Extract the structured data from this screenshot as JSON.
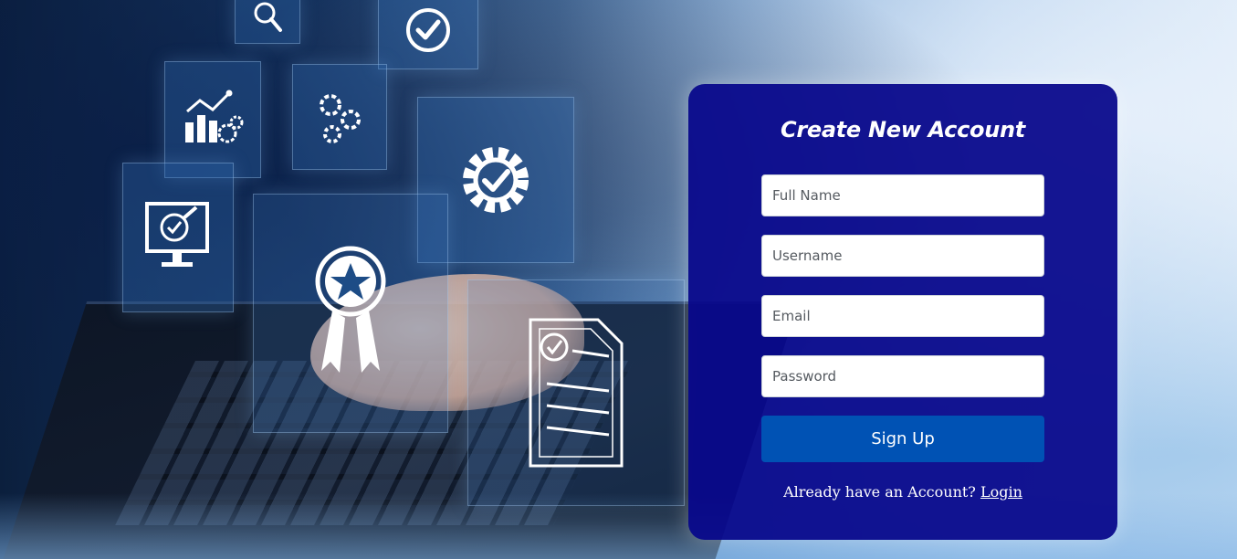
{
  "background": {
    "icons": [
      "search-icon",
      "checkmark-circle-icon",
      "analytics-chart-icon",
      "gears-icon",
      "gear-check-icon",
      "monitor-check-icon",
      "award-ribbon-icon",
      "document-check-icon"
    ]
  },
  "signup": {
    "title": "Create New Account",
    "fields": {
      "full_name": {
        "placeholder": "Full Name",
        "value": ""
      },
      "username": {
        "placeholder": "Username",
        "value": ""
      },
      "email": {
        "placeholder": "Email",
        "value": ""
      },
      "password": {
        "placeholder": "Password",
        "value": ""
      }
    },
    "submit_label": "Sign Up",
    "login_prompt": "Already have an Account?",
    "login_link": "Login"
  },
  "colors": {
    "card_bg": "#0a0a8c",
    "button_bg": "#0052b4",
    "text": "#ffffff"
  }
}
